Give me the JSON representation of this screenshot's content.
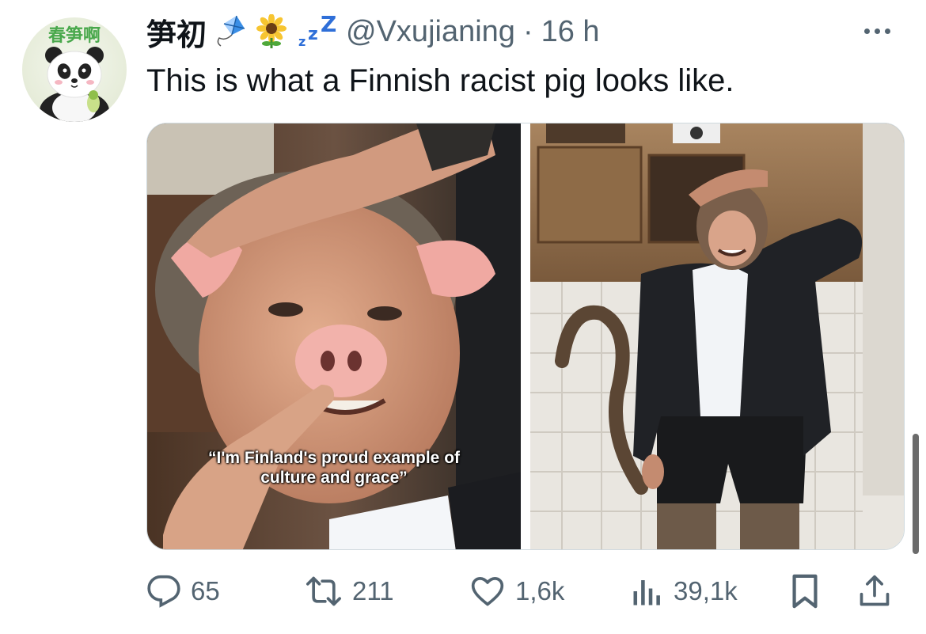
{
  "tweet": {
    "display_name": "笋初",
    "handle": "@Vxujianing",
    "separator": "·",
    "time": "16 h",
    "text": "This is what a Finnish racist pig looks like.",
    "name_emojis": [
      "kite-emoji",
      "sunflower-emoji",
      "zzz-emoji"
    ],
    "avatar_text": "春笋啊"
  },
  "media": {
    "left_caption": "“I'm Finland's proud example of culture and grace”"
  },
  "actions": {
    "replies": "65",
    "reposts": "211",
    "likes": "1,6k",
    "views": "39,1k"
  },
  "colors": {
    "text": "#0f1419",
    "secondary": "#536471",
    "border": "#cfd9de",
    "background": "#ffffff"
  }
}
